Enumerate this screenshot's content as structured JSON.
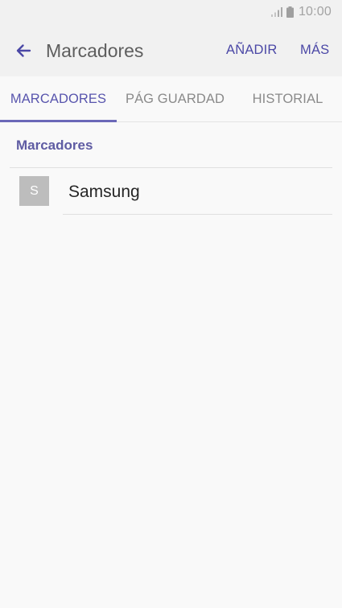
{
  "status_bar": {
    "time": "10:00",
    "icons": [
      "signal-icon",
      "battery-icon"
    ]
  },
  "app_bar": {
    "back_icon": "arrow-left-icon",
    "title": "Marcadores",
    "actions": {
      "add_label": "AÑADIR",
      "more_label": "MÁS"
    }
  },
  "tabs": [
    {
      "label": "MARCADORES",
      "selected": true
    },
    {
      "label": "PÁG GUARDAD",
      "selected": false
    },
    {
      "label": "HISTORIAL",
      "selected": false
    }
  ],
  "bookmarks_section": {
    "header": "Marcadores",
    "items": [
      {
        "favicon_letter": "S",
        "title": "Samsung"
      }
    ]
  },
  "colors": {
    "accent": "#4b48a6",
    "tab_selected": "#5855ad",
    "section_header": "#5f5ca3",
    "favicon_bg": "#bdbdbd"
  }
}
